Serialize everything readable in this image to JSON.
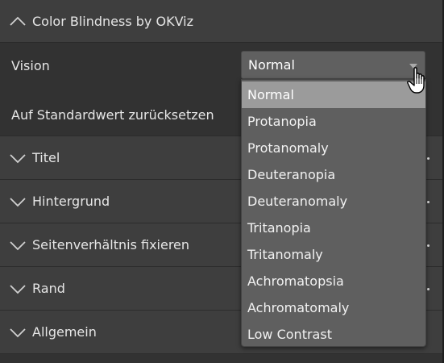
{
  "header": {
    "title": "Color Blindness by OKViz"
  },
  "vision": {
    "label": "Vision",
    "selected": "Normal",
    "options": [
      "Normal",
      "Protanopia",
      "Protanomaly",
      "Deuteranopia",
      "Deuteranomaly",
      "Tritanopia",
      "Tritanomaly",
      "Achromatopsia",
      "Achromatomaly",
      "Low Contrast"
    ]
  },
  "reset_label": "Auf Standardwert zurücksetzen",
  "sections": [
    {
      "label": "Titel"
    },
    {
      "label": "Hintergrund"
    },
    {
      "label": "Seitenverhältnis fixieren"
    },
    {
      "label": "Rand"
    },
    {
      "label": "Allgemein"
    }
  ],
  "icons": {
    "header_chevron": "chevron-up-icon",
    "section_chevron": "chevron-down-icon",
    "dropdown_caret": "caret-down-icon",
    "cursor": "hand-pointer-icon"
  },
  "colors": {
    "background": "#323232",
    "header_background": "#3e3e3e",
    "select_background": "#606060",
    "dropdown_background": "#5f5f5f",
    "selected_option": "#9b9b9b"
  }
}
